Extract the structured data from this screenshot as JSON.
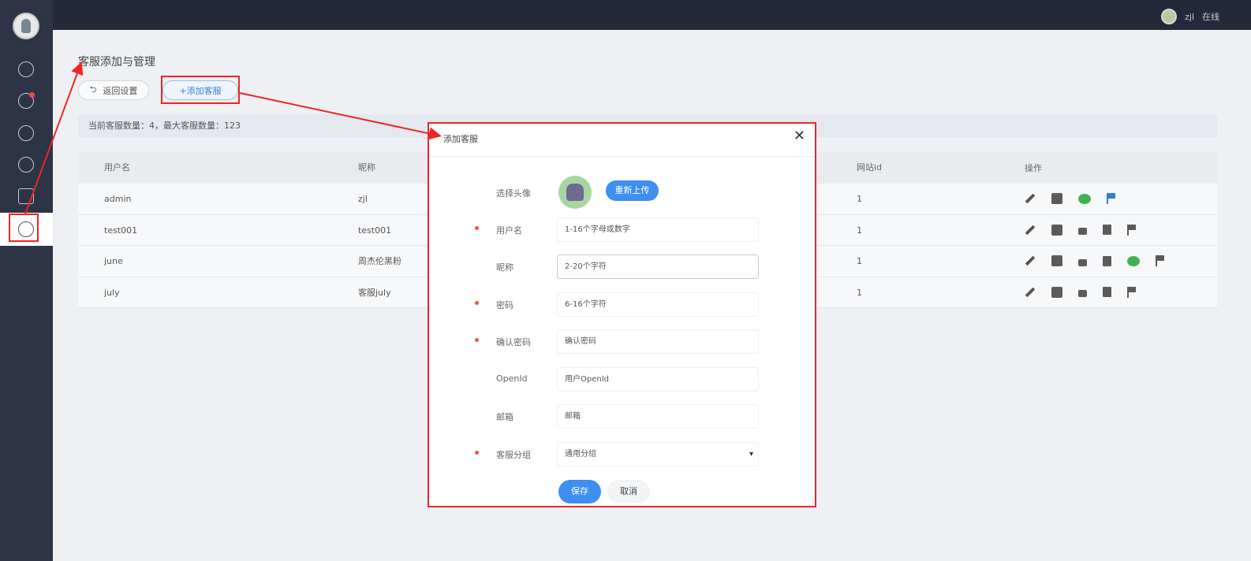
{
  "topbar": {
    "user_name": "zjl",
    "user_status": "在线"
  },
  "sidebar": {
    "items": [
      "home-icon",
      "chat-icon",
      "monitor-icon",
      "user-icon",
      "store-icon",
      "settings-icon"
    ]
  },
  "page": {
    "title": "客服添加与管理",
    "back_label": "返回设置",
    "add_label": "+添加客服",
    "info": "当前客服数量：4，最大客服数量：123"
  },
  "table": {
    "headers": [
      "用户名",
      "昵称",
      "网站id",
      "操作"
    ],
    "rows": [
      {
        "username": "admin",
        "nickname": "zjl",
        "site_id": "1"
      },
      {
        "username": "test001",
        "nickname": "test001",
        "site_id": "1"
      },
      {
        "username": "june",
        "nickname": "周杰伦黑粉",
        "site_id": "1"
      },
      {
        "username": "july",
        "nickname": "客服july",
        "site_id": "1"
      }
    ]
  },
  "modal": {
    "title": "添加客服",
    "close": "✕",
    "avatar_label": "选择头像",
    "reupload": "重新上传",
    "fields": [
      {
        "label": "用户名",
        "placeholder": "1-16个字母或数字",
        "required": true
      },
      {
        "label": "昵称",
        "placeholder": "2-20个字符",
        "required": false
      },
      {
        "label": "密码",
        "placeholder": "6-16个字符",
        "required": true
      },
      {
        "label": "确认密码",
        "placeholder": "确认密码",
        "required": true
      },
      {
        "label": "OpenId",
        "placeholder": "用户OpenId",
        "required": false
      },
      {
        "label": "邮箱",
        "placeholder": "邮箱",
        "required": false
      }
    ],
    "group_label": "客服分组",
    "group_value": "通用分组",
    "save": "保存",
    "cancel": "取消"
  },
  "colors": {
    "primary": "#3d8ff0",
    "highlight": "#f02424",
    "sidebar": "#2c3446"
  }
}
